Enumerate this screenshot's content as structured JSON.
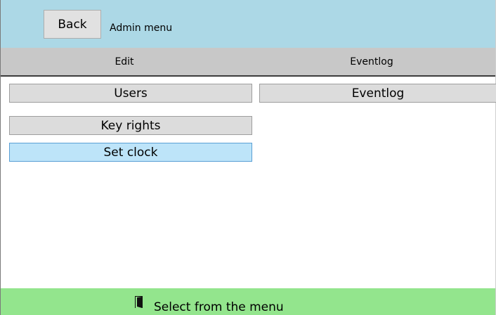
{
  "header": {
    "back_label": "Back",
    "title": "Admin menu"
  },
  "tabs": [
    {
      "label": "Edit"
    },
    {
      "label": "Eventlog"
    }
  ],
  "edit_column": {
    "items": [
      {
        "label": "Users",
        "selected": false
      },
      {
        "label": "Key rights",
        "selected": false
      },
      {
        "label": "Set clock",
        "selected": true
      }
    ]
  },
  "eventlog_column": {
    "items": [
      {
        "label": "Eventlog"
      }
    ]
  },
  "status": {
    "icon": "door-exit-icon",
    "text": "Select from the menu"
  },
  "colors": {
    "header_bg": "#acd8e6",
    "tab_bar_bg": "#c8c8c8",
    "button_bg": "#dcdcdc",
    "selected_bg": "#bde4f9",
    "status_bg": "#93e58d"
  }
}
